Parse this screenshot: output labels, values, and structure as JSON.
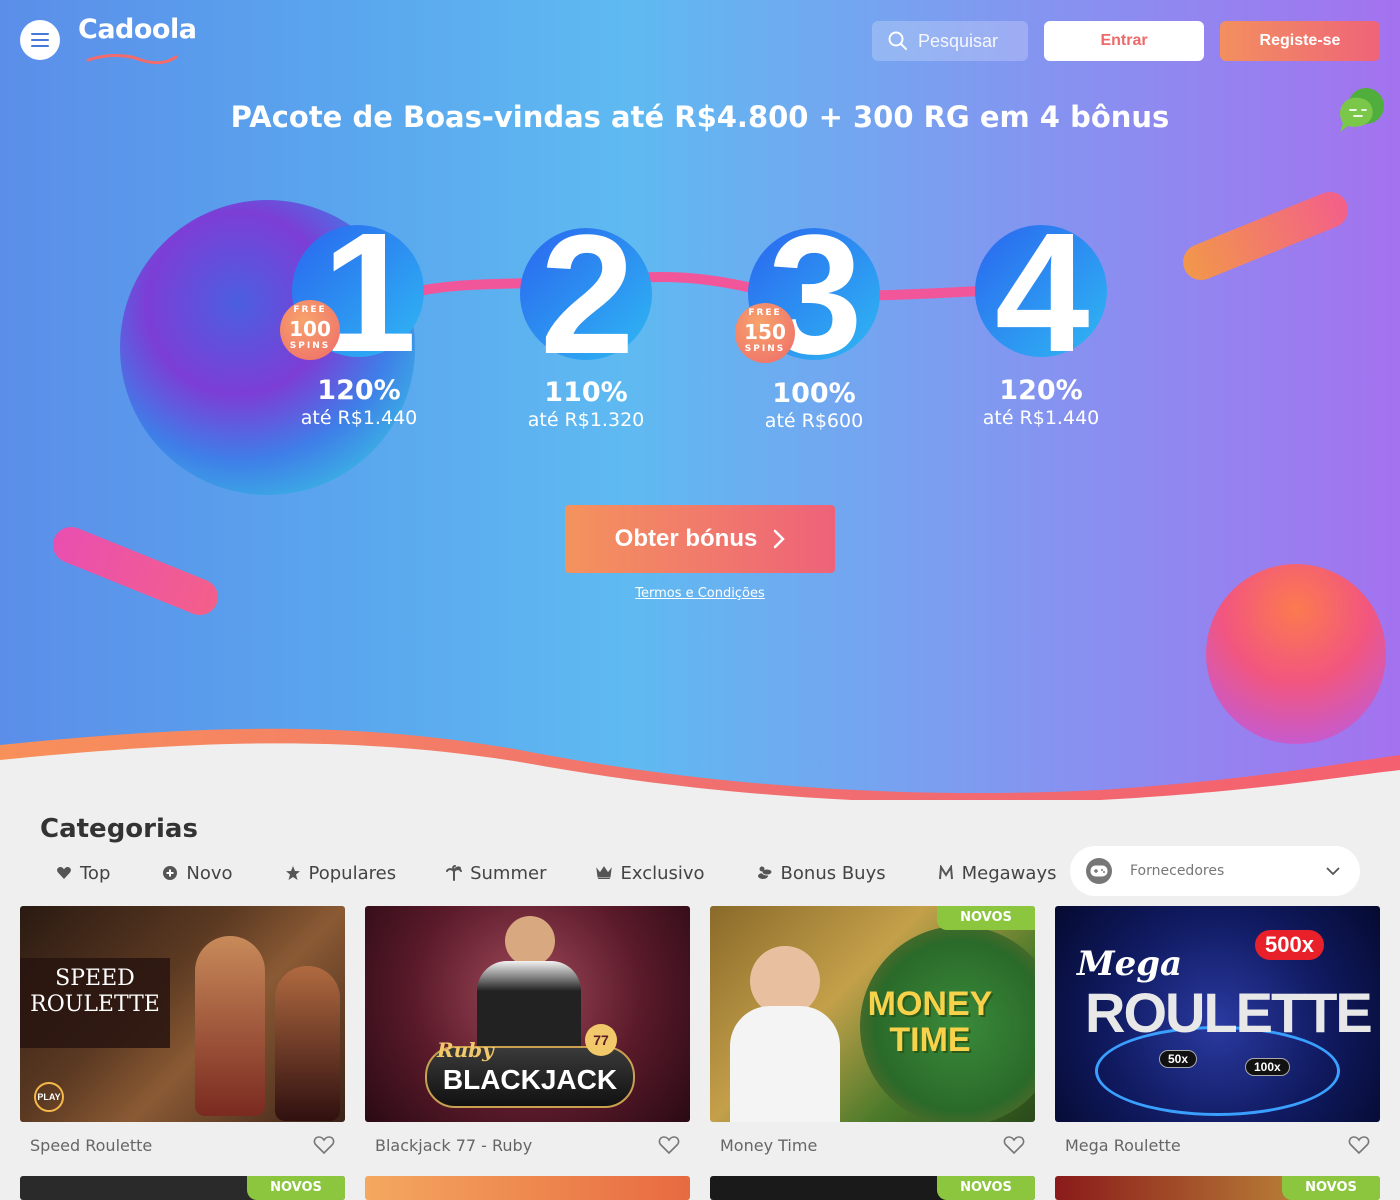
{
  "header": {
    "logo": "Cadoola",
    "search_placeholder": "Pesquisar",
    "login_label": "Entrar",
    "register_label": "Registe-se"
  },
  "hero": {
    "title": "PAcote de Boas-vindas até R$4.800 + 300 RG em 4 bônus",
    "steps": [
      {
        "number": "1",
        "percent": "120%",
        "max": "até R$1.440",
        "free_spins": {
          "top": "FREE",
          "count": "100",
          "bottom": "SPINS"
        }
      },
      {
        "number": "2",
        "percent": "110%",
        "max": "até R$1.320"
      },
      {
        "number": "3",
        "percent": "100%",
        "max": "até R$600",
        "free_spins": {
          "top": "FREE",
          "count": "150",
          "bottom": "SPINS"
        }
      },
      {
        "number": "4",
        "percent": "120%",
        "max": "até R$1.440"
      }
    ],
    "cta_label": "Obter bónus",
    "terms_label": "Termos e Condições"
  },
  "categories": {
    "title": "Categorias",
    "tabs": [
      {
        "label": "Top",
        "icon": "heart-icon"
      },
      {
        "label": "Novo",
        "icon": "plus-circle-icon"
      },
      {
        "label": "Populares",
        "icon": "star-icon"
      },
      {
        "label": "Summer",
        "icon": "palm-tree-icon"
      },
      {
        "label": "Exclusivo",
        "icon": "crown-icon"
      },
      {
        "label": "Bonus Buys",
        "icon": "coins-icon"
      },
      {
        "label": "Megaways",
        "icon": "megaways-icon"
      }
    ],
    "providers_placeholder": "Fornecedores"
  },
  "games": [
    {
      "name": "Speed Roulette",
      "art": "SPEED ROULETTE",
      "art_badge": "PLAY",
      "new": false
    },
    {
      "name": "Blackjack 77 - Ruby",
      "art": "BLACKJACK",
      "art_sub": "Ruby",
      "art_badge": "77",
      "new": false
    },
    {
      "name": "Money Time",
      "art": "MONEY TIME",
      "new": true
    },
    {
      "name": "Mega Roulette",
      "art": "ROULETTE",
      "art_sub": "Mega",
      "art_mult": [
        "500x",
        "50x",
        "100x"
      ],
      "new": true
    }
  ],
  "badge_new_label": "NOVOS",
  "colors": {
    "accent_orange": "#f28f5f",
    "accent_pink": "#ee6479",
    "new_badge": "#8cc63f"
  }
}
